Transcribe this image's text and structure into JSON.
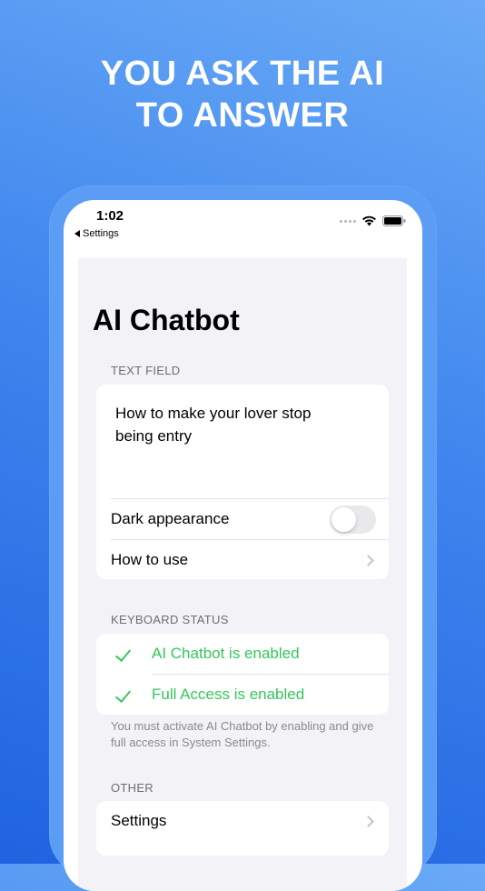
{
  "headline": {
    "line1": "YOU ASK THE AI",
    "line2": "TO ANSWER"
  },
  "status_bar": {
    "time": "1:02",
    "back_label": "Settings"
  },
  "app": {
    "title": "AI Chatbot",
    "text_field_section": {
      "header": "TEXT FIELD",
      "value": "How to make your lover stop being entry",
      "rows": [
        {
          "label": "Dark appearance",
          "toggle_on": false
        },
        {
          "label": "How to use"
        }
      ]
    },
    "keyboard_status_section": {
      "header": "KEYBOARD STATUS",
      "items": [
        {
          "label": "AI Chatbot is enabled",
          "icon": "checkmark-icon"
        },
        {
          "label": "Full Access is enabled",
          "icon": "checkmark-icon"
        }
      ],
      "footer": "You must activate AI Chatbot by enabling and give full access in System Settings."
    },
    "other_section": {
      "header": "OTHER",
      "rows": [
        {
          "label": "Settings"
        }
      ]
    }
  },
  "colors": {
    "accent_green": "#34c759",
    "background_gradient_start": "#6aaaf6",
    "background_gradient_end": "#1f63e0",
    "panel_background": "#f2f2f7"
  }
}
